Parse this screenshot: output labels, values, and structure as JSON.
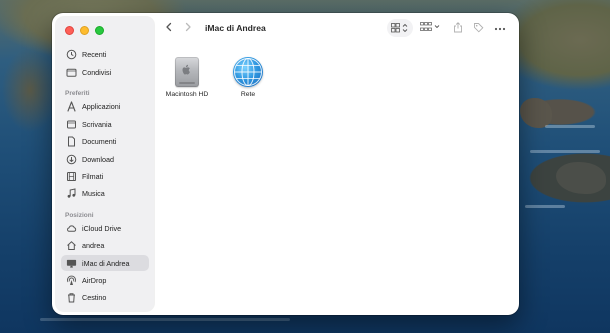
{
  "window": {
    "title": "iMac di Andrea"
  },
  "sidebar": {
    "top_items": [
      {
        "label": "Recenti",
        "icon": "clock-icon"
      },
      {
        "label": "Condivisi",
        "icon": "shared-folder-icon"
      }
    ],
    "favorites_heading": "Preferiti",
    "favorites": [
      {
        "label": "Applicazioni",
        "icon": "applications-icon"
      },
      {
        "label": "Scrivania",
        "icon": "desktop-icon"
      },
      {
        "label": "Documenti",
        "icon": "document-icon"
      },
      {
        "label": "Download",
        "icon": "download-icon"
      },
      {
        "label": "Filmati",
        "icon": "film-icon"
      },
      {
        "label": "Musica",
        "icon": "music-icon"
      }
    ],
    "locations_heading": "Posizioni",
    "locations": [
      {
        "label": "iCloud Drive",
        "icon": "cloud-icon"
      },
      {
        "label": "andrea",
        "icon": "home-icon"
      },
      {
        "label": "iMac di Andrea",
        "icon": "imac-icon",
        "selected": true
      },
      {
        "label": "AirDrop",
        "icon": "airdrop-icon"
      },
      {
        "label": "Cestino",
        "icon": "trash-icon"
      }
    ]
  },
  "content": {
    "items": [
      {
        "label": "Macintosh HD",
        "icon": "hard-drive-icon"
      },
      {
        "label": "Rete",
        "icon": "network-globe-icon"
      }
    ]
  },
  "colors": {
    "close": "#fe5f57",
    "minimize": "#febc2e",
    "zoom": "#28c840",
    "selection": "#dcdce0"
  }
}
